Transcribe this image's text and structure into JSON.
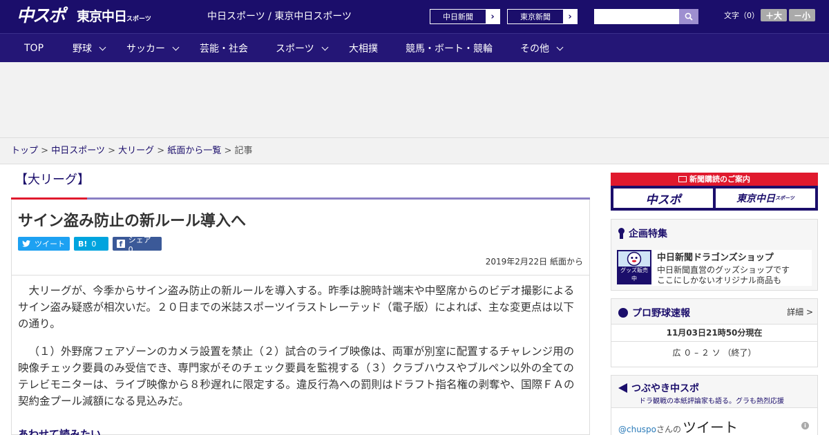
{
  "header": {
    "logo_main": "中スポ",
    "logo_tokyo": "東京中日",
    "logo_tokyo_small": "スポーツ",
    "site_names": "中日スポーツ / 東京中日スポーツ",
    "btn_chunichi": "中日新聞",
    "btn_tokyo": "東京新聞",
    "search_placeholder": "",
    "fontsize_label": "文字（0）",
    "btn_larger": "＋大",
    "btn_smaller": "－小"
  },
  "nav": [
    {
      "label": "TOP",
      "has_menu": false
    },
    {
      "label": "野球",
      "has_menu": true
    },
    {
      "label": "サッカー",
      "has_menu": true
    },
    {
      "label": "芸能・社会",
      "has_menu": false
    },
    {
      "label": "スポーツ",
      "has_menu": true
    },
    {
      "label": "大相撲",
      "has_menu": false
    },
    {
      "label": "競馬・ボート・競輪",
      "has_menu": false
    },
    {
      "label": "その他",
      "has_menu": true
    }
  ],
  "breadcrumb": {
    "items": [
      "トップ",
      "中日スポーツ",
      "大リーグ",
      "紙面から一覧"
    ],
    "current": "記事",
    "separator": ">"
  },
  "article": {
    "category": "【大リーグ】",
    "title": "サイン盗み防止の新ルール導入へ",
    "share_tweet": "ツイート",
    "share_hatena": "0",
    "share_hatena_icon": "B!",
    "share_fb": "シェア 0",
    "date": "2019年2月22日 紙面から",
    "paragraphs": [
      "大リーグが、今季からサイン盗み防止の新ルールを導入する。昨季は腕時計端末や中堅席からのビデオ撮影によるサイン盗み疑惑が相次いだ。２０日までの米誌スポーツイラストレーテッド（電子版）によれば、主な変更点は以下の通り。",
      "（１）外野席フェアゾーンのカメラ設置を禁止（２）試合のライブ映像は、両軍が別室に配置するチャレンジ用の映像チェック要員のみ受信でき、専門家がそのチェック要員を監視する（３）クラブハウスやブルペン以外の全てのテレビモニターは、ライブ映像から８秒遅れに限定する。違反行為への罰則はドラフト指名権の剥奪や、国際ＦＡの契約金プール減額になる見込みだ。"
    ],
    "more_heading": "あわせて読みたい"
  },
  "sidebar": {
    "subscribe_title": "新聞購読のご案内",
    "subscribe_left": "中スポ",
    "subscribe_right": "東京中日",
    "subscribe_right_small": "スポーツ",
    "feature_title": "企画特集",
    "shop_name": "中日新聞ドラゴンズショップ",
    "shop_desc1": "中日新聞直営のグッズショップです",
    "shop_desc2": "ここにしかないオリジナル商品も",
    "shop_img_label": "グッズ販売中",
    "score_title": "プロ野球速報",
    "score_detail": "詳細 >",
    "score_time": "11月03日21時50分現在",
    "score_result": "広 ０ – ２ ソ （終了）",
    "tsubuyaki_title": "つぶやき中スポ",
    "tsubuyaki_sub": "ドラ観戦の本紙評論家も語る。グラも熱烈応援",
    "tweet_user": "@chuspo",
    "tweet_san": "さんの",
    "tweet_label": "ツイート"
  },
  "colors": {
    "brand": "#1b0e6b",
    "accent_red": "#e0192d",
    "twitter": "#1da1f2",
    "hatena": "#00a4de",
    "facebook": "#3b5998"
  }
}
